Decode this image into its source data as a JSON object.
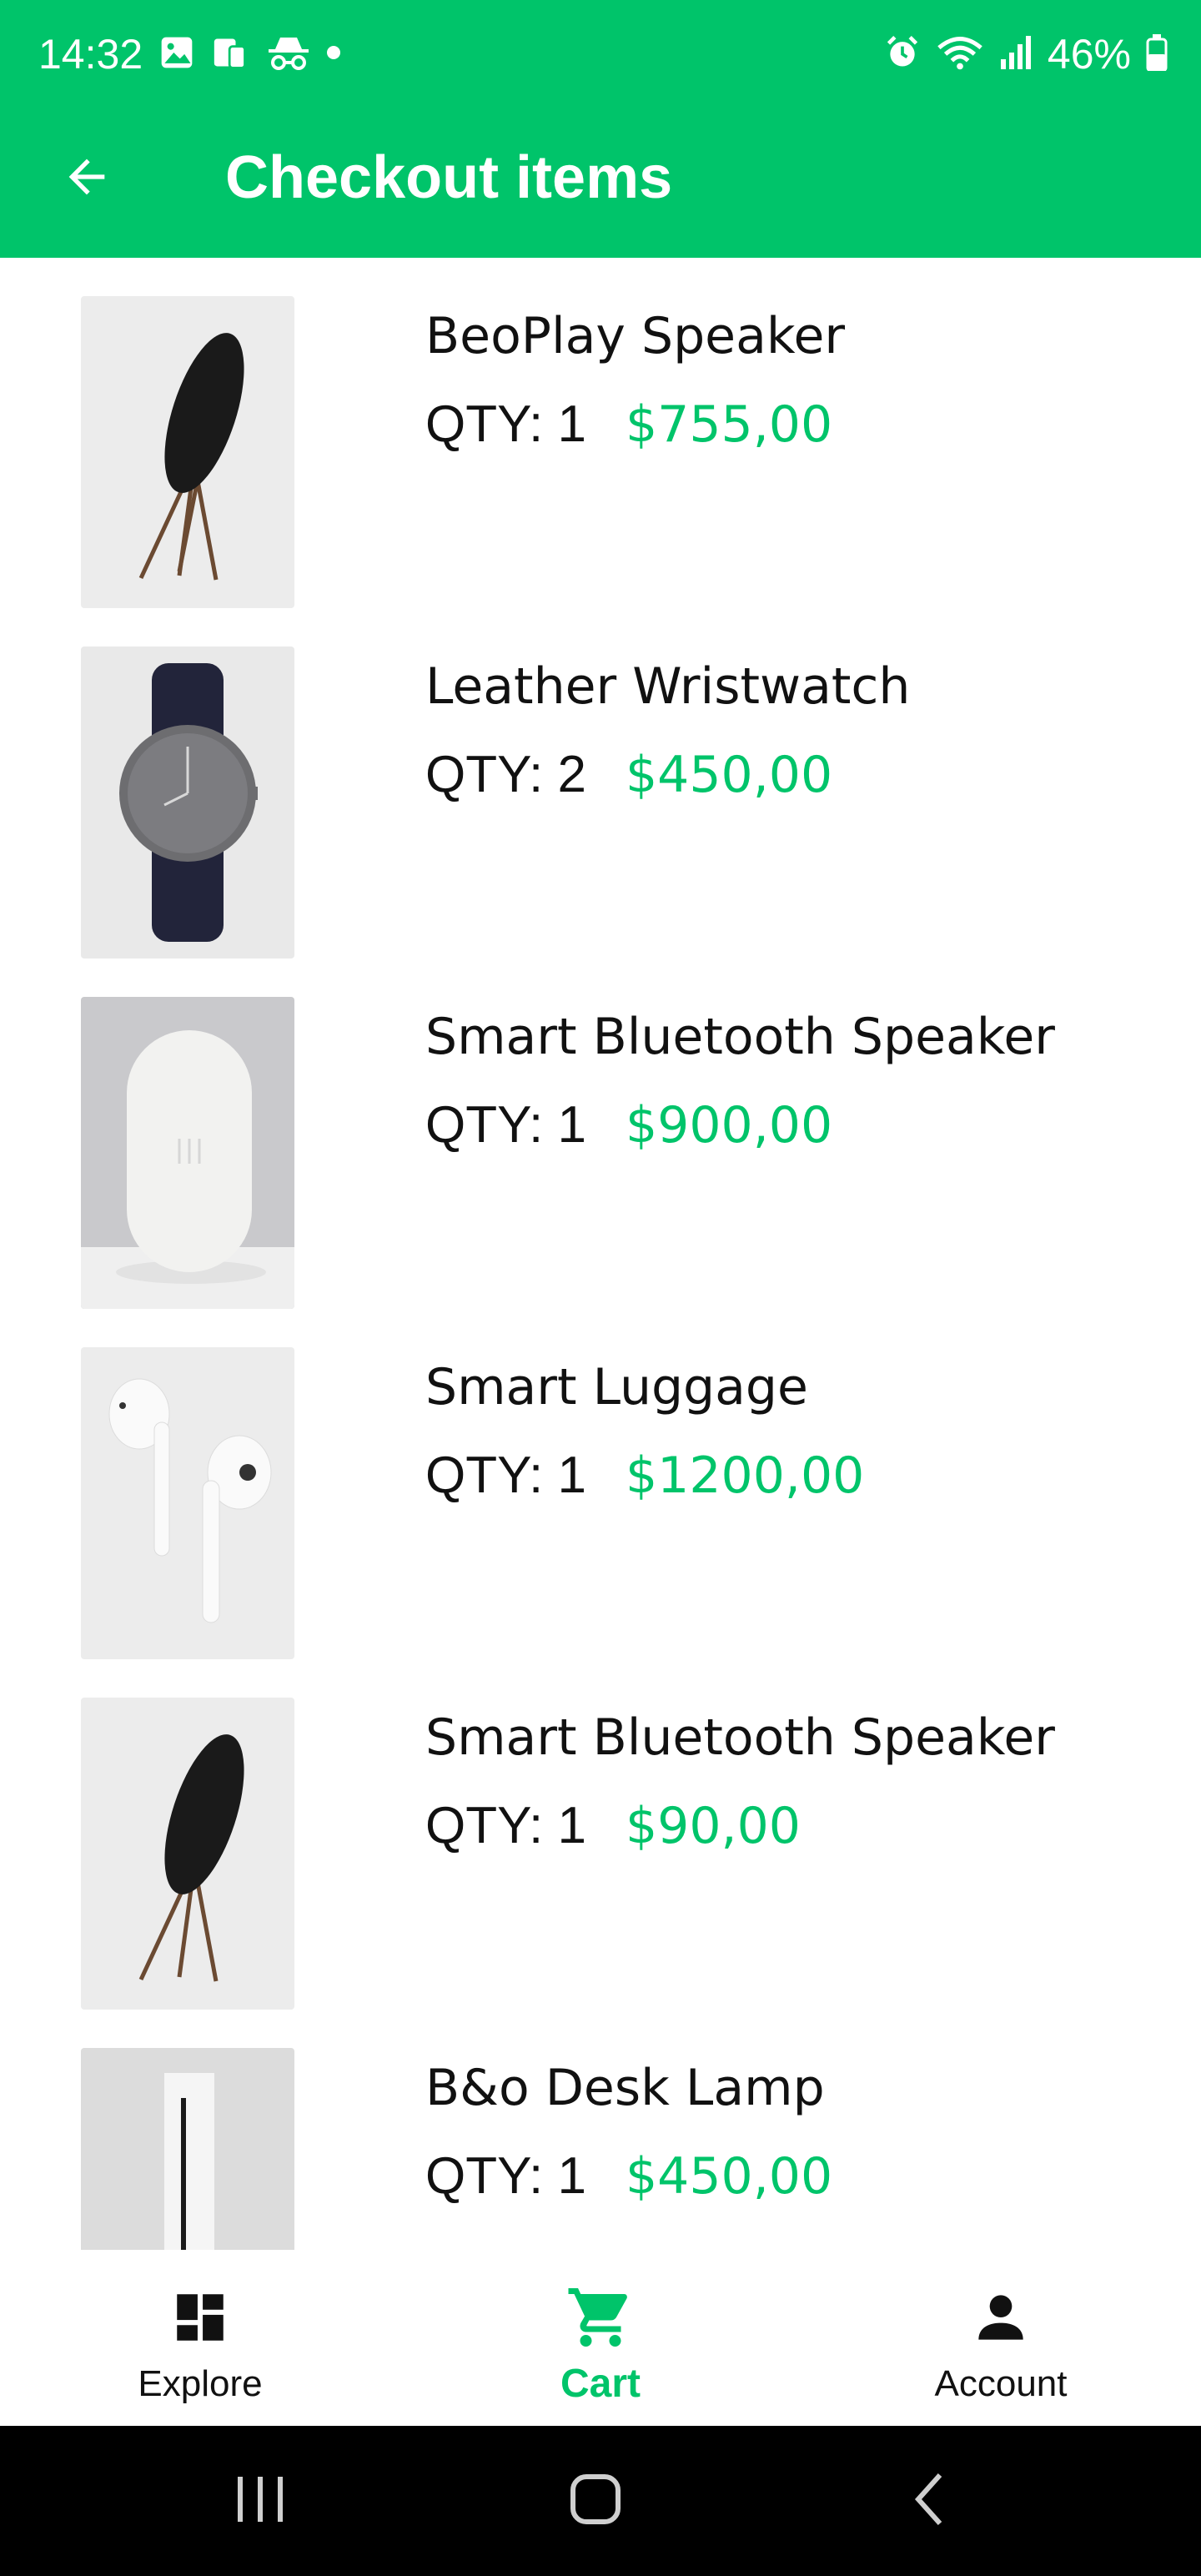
{
  "status_bar": {
    "time": "14:32",
    "battery": "46%"
  },
  "app_bar": {
    "title": "Checkout items"
  },
  "items": [
    {
      "name": "BeoPlay Speaker",
      "qty": "QTY: 1",
      "price": "$755,00",
      "image": "speaker-on-stand"
    },
    {
      "name": "Leather Wristwatch",
      "qty": "QTY: 2",
      "price": "$450,00",
      "image": "wristwatch"
    },
    {
      "name": "Smart Bluetooth Speaker",
      "qty": "QTY: 1",
      "price": "$900,00",
      "image": "white-speaker"
    },
    {
      "name": "Smart Luggage",
      "qty": "QTY: 1",
      "price": "$1200,00",
      "image": "earbuds"
    },
    {
      "name": "Smart Bluetooth Speaker",
      "qty": "QTY: 1",
      "price": "$90,00",
      "image": "speaker-on-stand"
    },
    {
      "name": "B&o Desk Lamp",
      "qty": "QTY: 1",
      "price": "$450,00",
      "image": "desk-lamp"
    }
  ],
  "bottom_nav": {
    "explore": "Explore",
    "cart": "Cart",
    "account": "Account",
    "active": "cart"
  },
  "colors": {
    "brand": "#00c46a",
    "text": "#111111"
  }
}
